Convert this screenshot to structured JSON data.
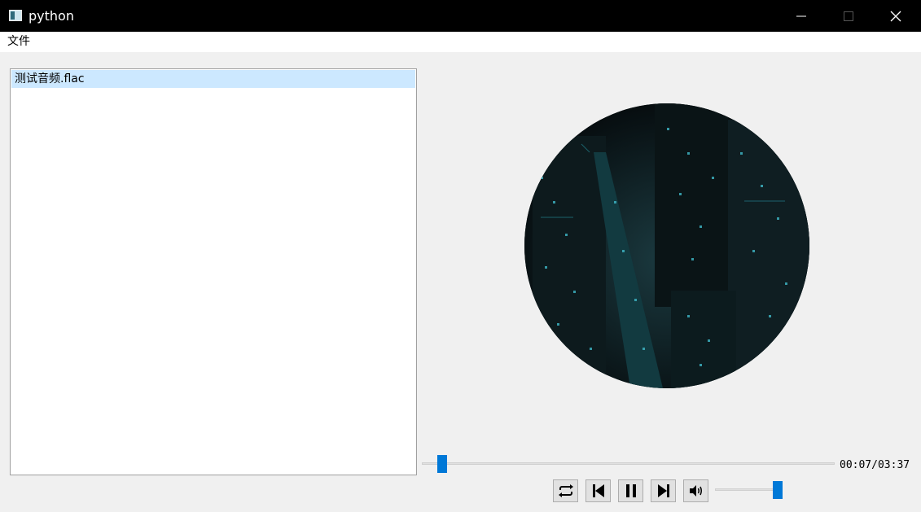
{
  "window": {
    "title": "python"
  },
  "menu": {
    "items": [
      {
        "label": "文件"
      }
    ]
  },
  "playlist": {
    "items": [
      {
        "label": "测试音频.flac",
        "selected": true
      }
    ]
  },
  "player": {
    "time": "00:07/03:37",
    "progress_fraction": 0.032,
    "volume_fraction": 0.9,
    "buttons": [
      {
        "name": "loop-button",
        "icon": "repeat-icon"
      },
      {
        "name": "previous-button",
        "icon": "skip-previous-icon"
      },
      {
        "name": "pause-button",
        "icon": "pause-icon"
      },
      {
        "name": "next-button",
        "icon": "skip-next-icon"
      },
      {
        "name": "volume-button",
        "icon": "speaker-icon"
      }
    ]
  },
  "colors": {
    "titlebar": "#000000",
    "accent": "#0078d7",
    "selection": "#cce8ff",
    "background": "#f0f0f0"
  }
}
